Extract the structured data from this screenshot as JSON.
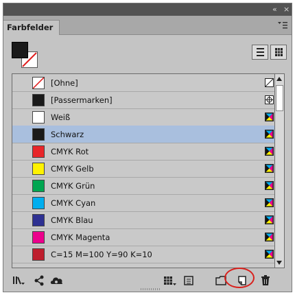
{
  "panel": {
    "tab_label": "Farbfelder",
    "collapse_glyph": "«",
    "close_glyph": "×"
  },
  "swatches": [
    {
      "name": "[Ohne]",
      "color": "none",
      "mode": "none"
    },
    {
      "name": "[Passermarken]",
      "color": "#1a1a1a",
      "mode": "registration"
    },
    {
      "name": "Weiß",
      "color": "#ffffff",
      "mode": "process"
    },
    {
      "name": "Schwarz",
      "color": "#1a1a1a",
      "mode": "process",
      "selected": true
    },
    {
      "name": "CMYK Rot",
      "color": "#e8262a",
      "mode": "process"
    },
    {
      "name": "CMYK Gelb",
      "color": "#fff200",
      "mode": "process"
    },
    {
      "name": "CMYK Grün",
      "color": "#00a651",
      "mode": "process"
    },
    {
      "name": "CMYK Cyan",
      "color": "#00aeef",
      "mode": "process"
    },
    {
      "name": "CMYK Blau",
      "color": "#2e3192",
      "mode": "process"
    },
    {
      "name": "CMYK Magenta",
      "color": "#ec008c",
      "mode": "process"
    },
    {
      "name": "C=15 M=100 Y=90 K=10",
      "color": "#be1e2d",
      "mode": "process"
    }
  ],
  "highlight_color": "#d9201c",
  "icons": {
    "fill": "fill-swatch-icon",
    "stroke": "stroke-none-icon",
    "list_view": "list-view-icon",
    "grid_view": "grid-view-icon",
    "show_all": "show-swatches-icon",
    "share": "share-icon",
    "library": "cc-library-icon",
    "show_grid": "swatch-grid-icon",
    "show_list": "swatch-list-icon",
    "group": "new-color-group-icon",
    "new": "new-swatch-icon",
    "delete": "trash-icon"
  }
}
